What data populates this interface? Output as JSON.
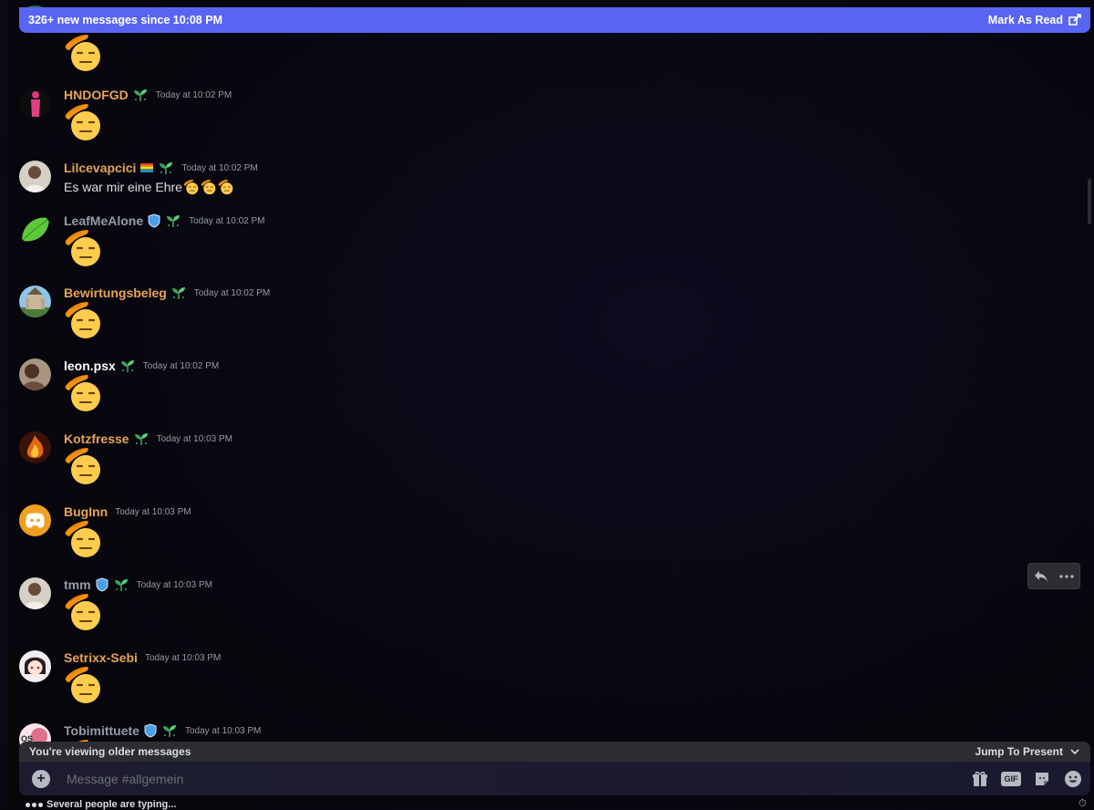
{
  "banner": {
    "new_messages": "326+ new messages since 10:08 PM",
    "mark_read": "Mark As Read"
  },
  "messages": [
    {
      "name": "",
      "color": "#e6b35a",
      "timestamp": "",
      "badges": [],
      "content_type": "emoji",
      "avatar": "partial"
    },
    {
      "name": "HNDOFGD",
      "color": "#e6a356",
      "timestamp": "Today at 10:02 PM",
      "badges": [
        "sprout"
      ],
      "content_type": "emoji",
      "avatar": "pink-figure"
    },
    {
      "name": "Lilcevapcici",
      "color": "#e6a356",
      "timestamp": "Today at 10:02 PM",
      "badges": [
        "rainbow-heart",
        "sprout"
      ],
      "content_type": "text",
      "text": "Es war mir eine Ehre",
      "avatar": "portrait-light"
    },
    {
      "name": "LeafMeAlone",
      "color": "#949ba4",
      "timestamp": "Today at 10:02 PM",
      "badges": [
        "shield",
        "sprout"
      ],
      "content_type": "emoji",
      "avatar": "leaf"
    },
    {
      "name": "Bewirtungsbeleg",
      "color": "#e6a356",
      "timestamp": "Today at 10:02 PM",
      "badges": [
        "sprout"
      ],
      "content_type": "emoji",
      "avatar": "castle"
    },
    {
      "name": "leon.psx",
      "color": "#ffffff",
      "timestamp": "Today at 10:02 PM",
      "badges": [
        "sprout"
      ],
      "content_type": "emoji",
      "avatar": "portrait-dark"
    },
    {
      "name": "Kotzfresse",
      "color": "#e6a356",
      "timestamp": "Today at 10:03 PM",
      "badges": [
        "sprout"
      ],
      "content_type": "emoji",
      "avatar": "fire"
    },
    {
      "name": "BugInn",
      "color": "#e6a356",
      "timestamp": "Today at 10:03 PM",
      "badges": [],
      "content_type": "emoji",
      "avatar": "discord"
    },
    {
      "name": "tmm",
      "color": "#949ba4",
      "timestamp": "Today at 10:03 PM",
      "badges": [
        "shield",
        "sprout"
      ],
      "content_type": "emoji",
      "avatar": "portrait-light"
    },
    {
      "name": "Setrixx-Sebi",
      "color": "#e6a356",
      "timestamp": "Today at 10:03 PM",
      "badges": [],
      "content_type": "emoji",
      "avatar": "anime"
    },
    {
      "name": "Tobimittuete",
      "color": "#949ba4",
      "timestamp": "Today at 10:03 PM",
      "badges": [
        "shield",
        "sprout"
      ],
      "content_type": "emoji",
      "avatar": "pink"
    }
  ],
  "older_bar": {
    "label": "You're viewing older messages",
    "jump": "Jump To Present"
  },
  "composer": {
    "placeholder": "Message #allgemein"
  },
  "typing": {
    "text": "Several people are typing..."
  },
  "colors": {
    "accent": "#5865f2",
    "username_orange": "#e6a356",
    "timestamp": "#949ba4"
  }
}
